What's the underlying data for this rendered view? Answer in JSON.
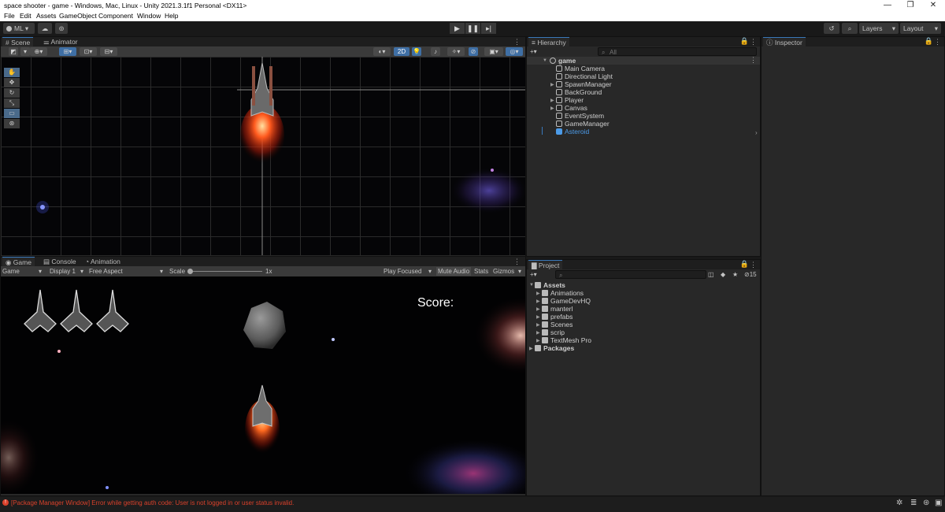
{
  "window": {
    "title": "space shooter - game - Windows, Mac, Linux - Unity 2021.3.1f1 Personal <DX11>",
    "min": "—",
    "max": "❐",
    "close": "✕"
  },
  "menu": [
    "File",
    "Edit",
    "Assets",
    "GameObject",
    "Component",
    "Window",
    "Help"
  ],
  "toolbar": {
    "account": "ML ▾",
    "layers": "Layers",
    "layout": "Layout"
  },
  "scene_panel": {
    "tabs": [
      "Scene",
      "Animator"
    ],
    "mode_2d": "2D"
  },
  "game_panel": {
    "tabs": [
      "Console",
      "Animation"
    ],
    "active_tab": "Game",
    "game_dropdown": "Game",
    "display": "Display 1",
    "aspect": "Free Aspect",
    "scale_label": "Scale",
    "scale_value": "1x",
    "play_mode": "Play Focused",
    "mute": "Mute Audio",
    "stats": "Stats",
    "gizmos": "Gizmos",
    "score_label": "Score:"
  },
  "hierarchy": {
    "tab": "Hierarchy",
    "search_placeholder": "All",
    "scene_name": "game",
    "items": [
      {
        "label": "Main Camera"
      },
      {
        "label": "Directional Light"
      },
      {
        "label": "SpawnManager"
      },
      {
        "label": "BackGround"
      },
      {
        "label": "Player"
      },
      {
        "label": "Canvas"
      },
      {
        "label": "EventSystem"
      },
      {
        "label": "GameManager"
      },
      {
        "label": "Asteroid"
      }
    ]
  },
  "project": {
    "tab": "Project",
    "hidden_count": "15",
    "root": "Assets",
    "folders": [
      "Animations",
      "GameDevHQ",
      "manterl",
      "prefabs",
      "Scenes",
      "scrip",
      "TextMesh Pro"
    ],
    "packages": "Packages"
  },
  "inspector": {
    "tab": "Inspector"
  },
  "status": {
    "error": "[Package Manager Window] Error while getting auth code: User is not logged in or user status invalid."
  },
  "colors": {
    "accent": "#3a79bb",
    "selected_text": "#4c9be8",
    "error_text": "#d9412b",
    "panel_bg": "#282828"
  }
}
